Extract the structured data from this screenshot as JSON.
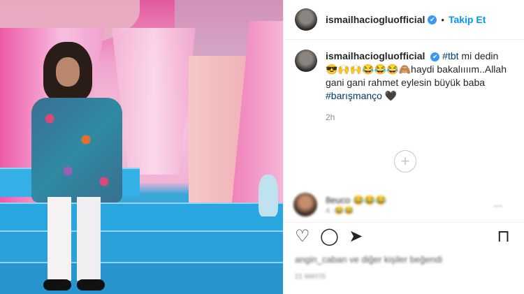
{
  "header": {
    "username": "ismailhaciogluofficial",
    "verified": "✔",
    "separator": "•",
    "follow_label": "Takip Et"
  },
  "caption": {
    "username": "ismailhaciogluofficial",
    "verified": "✔",
    "hashtag1": "#tbt",
    "text1": " mi dedin ",
    "emojis": "😎🙌🙌😂😂😂🙈",
    "text2": "haydi bakalıııım..Allah gani gani rahmet eylesin büyük baba ",
    "hashtag2": "#barışmanço",
    "heart": " 🖤",
    "time": "2h"
  },
  "load_more": "+",
  "comment": {
    "username": "8euco",
    "emojis": "😂😂😂",
    "sub": "4 ·😂😂",
    "dots": "◦◦◦"
  },
  "actions": {
    "like_icon": "♡",
    "comment_icon": "◯",
    "share_icon": "➤",
    "save_icon": "⊓"
  },
  "likes_text": "angin_caban ve diğer kişiler beğendi",
  "date_text": "21 MAYIS"
}
